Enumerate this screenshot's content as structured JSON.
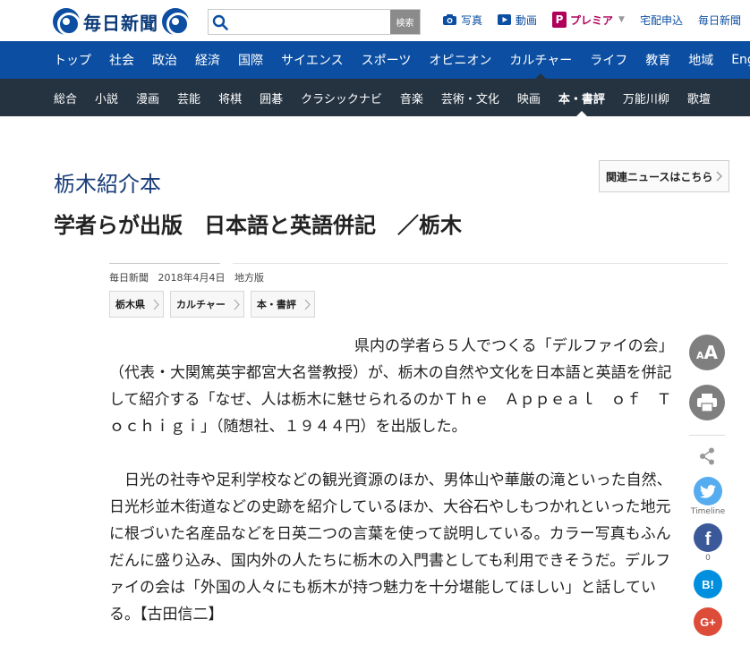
{
  "header": {
    "logo_text": "毎日新聞",
    "search": {
      "placeholder": "",
      "button_label": "検索"
    },
    "links": [
      {
        "label": "写真"
      },
      {
        "label": "動画"
      },
      {
        "label": "プレミア",
        "badge": "P"
      },
      {
        "label": "宅配申込"
      },
      {
        "label": "毎日新聞"
      }
    ]
  },
  "nav_primary": [
    "トップ",
    "社会",
    "政治",
    "経済",
    "国際",
    "サイエンス",
    "スポーツ",
    "オピニオン",
    "カルチャー",
    "ライフ",
    "教育",
    "地域",
    "Eng"
  ],
  "nav_primary_active": "カルチャー",
  "nav_secondary": [
    "総合",
    "小説",
    "漫画",
    "芸能",
    "将棋",
    "囲碁",
    "クラシックナビ",
    "音楽",
    "芸術・文化",
    "映画",
    "本・書評",
    "万能川柳",
    "歌壇"
  ],
  "nav_secondary_active": "本・書評",
  "article": {
    "kicker": "栃木紹介本",
    "headline": "学者らが出版　日本語と英語併記　／栃木",
    "related_label": "関連ニュースはこちら",
    "meta": {
      "source": "毎日新聞",
      "date": "2018年4月4日",
      "edition": "地方版"
    },
    "tags": [
      "栃木県",
      "カルチャー",
      "本・書評"
    ],
    "paragraphs": [
      "県内の学者ら５人でつくる「デルファイの会」（代表・大関篤英宇都宮大名誉教授）が、栃木の自然や文化を日本語と英語を併記して紹介する「なぜ、人は栃木に魅せられるのかＴｈｅ　Ａｐｐｅａｌ　ｏｆ　Ｔｏｃｈｉｇｉ」（随想社、１９４４円）を出版した。",
      "日光の社寺や足利学校などの観光資源のほか、男体山や華厳の滝といった自然、日光杉並木街道などの史跡を紹介しているほか、大谷石やしもつかれといった地元に根づいた名産品などを日英二つの言葉を使って説明している。カラー写真もふんだんに盛り込み、国内外の人たちに栃木の入門書としても利用できそうだ。デルファイの会は「外国の人々にも栃木が持つ魅力を十分堪能してほしい」と話している。【古田信二】"
    ]
  },
  "share": {
    "font_size_label": "A",
    "twitter_label": "Timeline",
    "facebook_count": "0",
    "hatena_label": "B!",
    "google_label": "G+"
  },
  "colors": {
    "brand_blue": "#0b4ea2",
    "subnav_dark": "#253341",
    "premier": "#b0005a",
    "twitter": "#55acee",
    "facebook": "#3b5998",
    "hatena": "#008fde",
    "google": "#dd4b39"
  }
}
